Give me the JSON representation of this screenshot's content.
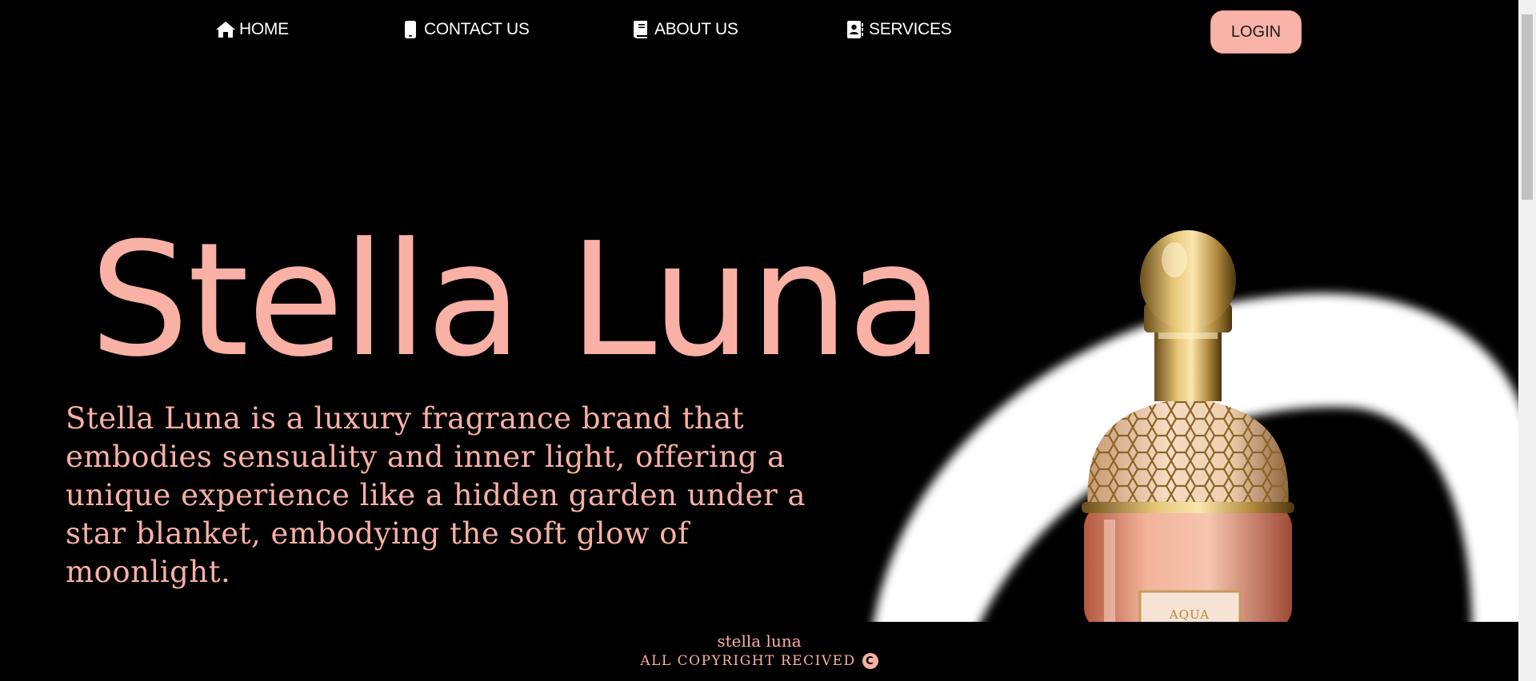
{
  "nav": {
    "home_label": "HOME",
    "contact_label": "CONTACT US",
    "about_label": "ABOUT US",
    "services_label": "SERVICES",
    "login_label": "LOGIN"
  },
  "hero": {
    "title": "Stella Luna",
    "description": "Stella Luna is a luxury fragrance brand that embodies sensuality and inner light, offering a unique experience like a hidden garden under a star blanket, embodying the soft glow of moonlight.",
    "image_label": "AQUA"
  },
  "footer": {
    "brand": "stella luna",
    "copyright": "ALL COPYRIGHT RECIVED"
  },
  "colors": {
    "background": "#000000",
    "accent_pink": "#f9b0a5",
    "nav_text": "#ffffff"
  },
  "icons": {
    "home": "home-icon",
    "contact": "phone-icon",
    "about": "book-icon",
    "services": "address-book-icon",
    "copyright": "copyright-icon"
  }
}
